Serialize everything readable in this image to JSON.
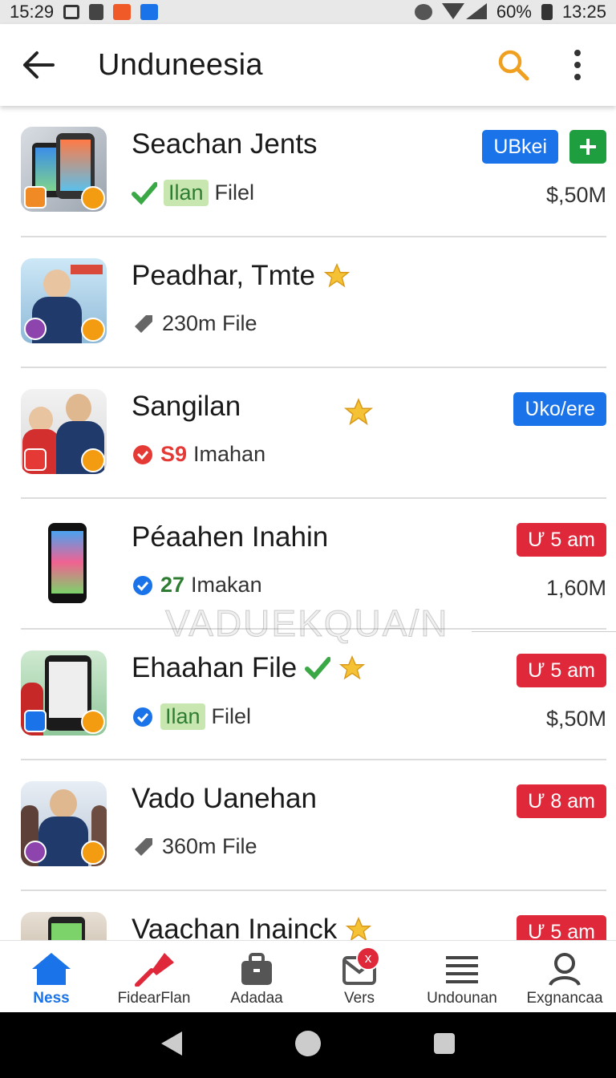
{
  "status": {
    "time_left": "15:29",
    "battery": "60%",
    "time_right": "13:25"
  },
  "header": {
    "title": "Unduneesia"
  },
  "items": [
    {
      "title": "Seachan Jents",
      "chip": "Ilan",
      "meta": "Filel",
      "action": "UBkei",
      "size": "$,50M"
    },
    {
      "title": "Peadhar, Tmte",
      "meta": "230m File"
    },
    {
      "title": "Sangilan",
      "count": "S9",
      "meta": "Imahan",
      "action": "Ʋko/ere"
    },
    {
      "title": "Péaahen Inahin",
      "count": "27",
      "meta": "Imakan",
      "action": "Ư 5 am",
      "size": "1,60M"
    },
    {
      "title": "Ehaahan File",
      "chip": "Ilan",
      "meta": "Filel",
      "action": "Ư 5 am",
      "size": "$,50M"
    },
    {
      "title": "Vado Uanehan",
      "meta": "360m File",
      "action": "Ư 8 am"
    },
    {
      "title": "Vaachan Inainck",
      "action": "Ư 5 am"
    }
  ],
  "watermark": "VADUEKQUA/N",
  "nav": [
    {
      "label": "Ness",
      "icon": "home-icon"
    },
    {
      "label": "FidearFlan",
      "icon": "pushpin-icon"
    },
    {
      "label": "Adadaa",
      "icon": "briefcase-icon"
    },
    {
      "label": "Vers",
      "icon": "mail-icon",
      "badge": "x"
    },
    {
      "label": "Undounan",
      "icon": "list-icon"
    },
    {
      "label": "Exgnancaa",
      "icon": "person-icon"
    }
  ],
  "colors": {
    "accent": "#1a73e8",
    "red": "#e0283b",
    "green": "#1e9e3e",
    "search_orange": "#f0a020"
  }
}
